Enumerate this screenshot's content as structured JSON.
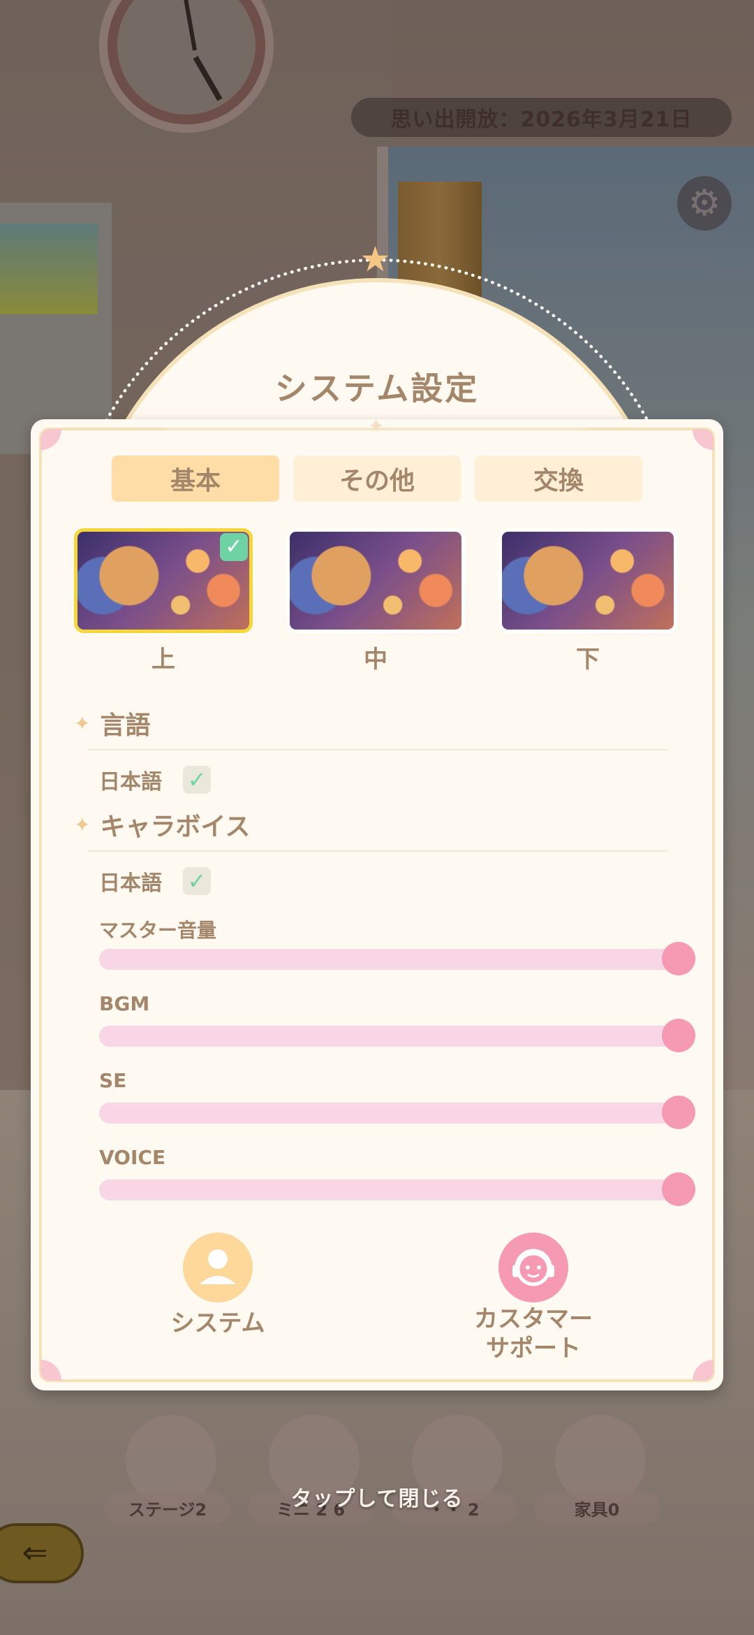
{
  "background": {
    "memory_text": "思い出開放：2026年3月21日",
    "nav": [
      {
        "label": "ステージ2"
      },
      {
        "label": "ミニ 2 6"
      },
      {
        "label": "・・ 2"
      },
      {
        "label": "家具0"
      }
    ]
  },
  "dialog": {
    "title": "システム設定",
    "tabs": [
      {
        "label": "基本",
        "active": true
      },
      {
        "label": "その他",
        "active": false
      },
      {
        "label": "交換",
        "active": false
      }
    ],
    "card_positions": [
      {
        "label": "上",
        "selected": true
      },
      {
        "label": "中",
        "selected": false
      },
      {
        "label": "下",
        "selected": false
      }
    ],
    "language": {
      "heading": "言語",
      "option": "日本語",
      "checked": true
    },
    "voice_language": {
      "heading": "キャラボイス",
      "option": "日本語",
      "checked": true
    },
    "sliders": [
      {
        "label": "マスター音量",
        "value": 1.0
      },
      {
        "label": "BGM",
        "value": 1.0
      },
      {
        "label": "SE",
        "value": 1.0
      },
      {
        "label": "VOICE",
        "value": 1.0
      }
    ],
    "actions": {
      "system": {
        "label": "システム"
      },
      "support": {
        "label_line1": "カスタマー",
        "label_line2": "サポート"
      }
    }
  },
  "footer": {
    "tap_close": "タップして閉じる"
  },
  "colors": {
    "accent_text": "#a4866a",
    "tab_active": "#fedea6",
    "tab_inactive": "#feefd6",
    "slider_track": "#f8d6e6",
    "slider_thumb": "#f59ab2",
    "check": "#6dd3a4",
    "selected_border": "#f5d73a",
    "system_button": "#fed79a",
    "support_button": "#f59ab2"
  }
}
